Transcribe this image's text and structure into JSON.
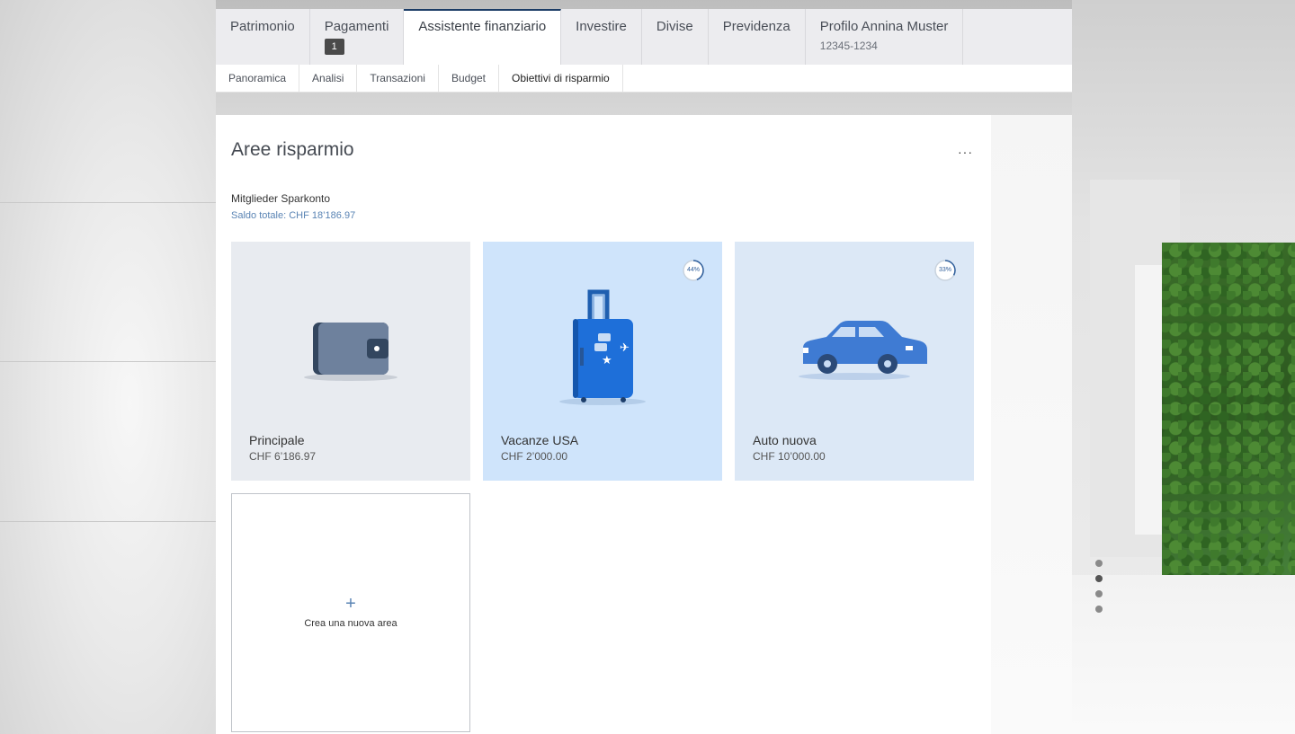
{
  "nav": {
    "tabs": [
      {
        "label": "Patrimonio"
      },
      {
        "label": "Pagamenti",
        "badge": "1"
      },
      {
        "label": "Assistente finanziario",
        "active": true
      },
      {
        "label": "Investire"
      },
      {
        "label": "Divise"
      },
      {
        "label": "Previdenza"
      },
      {
        "label": "Profilo Annina Muster",
        "sub": "12345-1234"
      }
    ],
    "subtabs": [
      {
        "label": "Panoramica"
      },
      {
        "label": "Analisi"
      },
      {
        "label": "Transazioni"
      },
      {
        "label": "Budget"
      },
      {
        "label": "Obiettivi di risparmio",
        "active": true
      }
    ]
  },
  "main": {
    "title": "Aree risparmio",
    "more_label": "···",
    "account_name": "Mitglieder Sparkonto",
    "account_total": "Saldo totale: CHF 18’186.97",
    "cards": [
      {
        "name": "Principale",
        "amount": "CHF 6’186.97",
        "icon": "wallet-icon"
      },
      {
        "name": "Vacanze USA",
        "amount": "CHF 2’000.00",
        "icon": "suitcase-icon",
        "progress_label": "44%",
        "progress": 0.44
      },
      {
        "name": "Auto nuova",
        "amount": "CHF 10’000.00",
        "icon": "car-icon",
        "progress_label": "33%",
        "progress": 0.33
      }
    ],
    "add_card": {
      "plus": "+",
      "label": "Crea una nuova area"
    }
  },
  "colors": {
    "accent": "#1b3c66",
    "card_neutral": "#e8ebf0",
    "card_active": "#cfe4fb",
    "card_light": "#dce8f6",
    "link": "#5a84b4"
  }
}
